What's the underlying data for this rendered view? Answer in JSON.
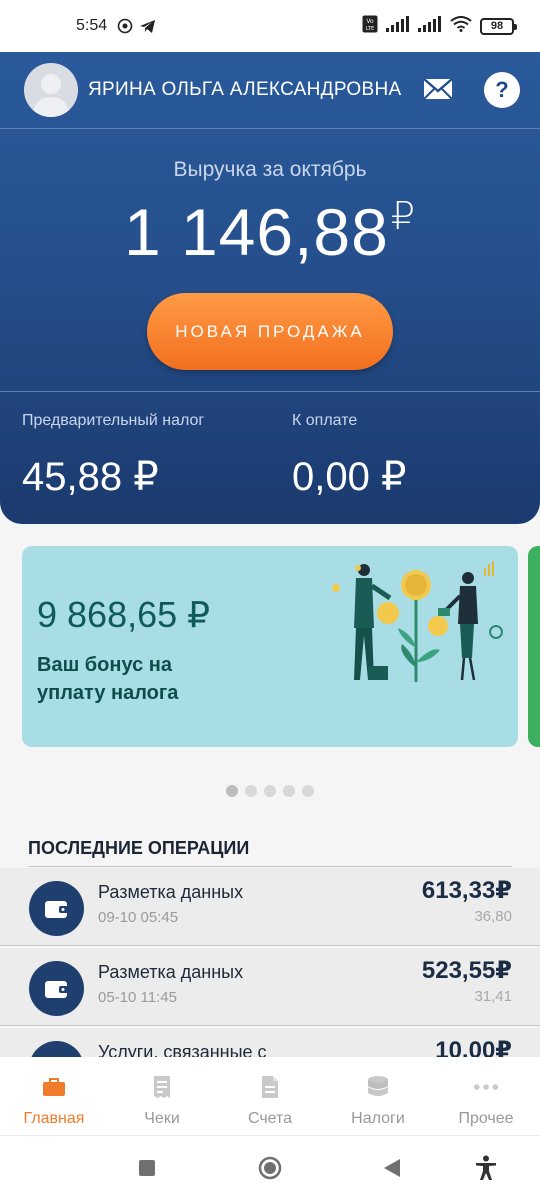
{
  "status_bar": {
    "time": "5:54",
    "battery": "98"
  },
  "header": {
    "user_name": "ЯРИНА ОЛЬГА АЛЕКСАНДРОВНА",
    "help_label": "?"
  },
  "revenue": {
    "label": "Выручка за октябрь",
    "amount": "1 146,88",
    "currency": "₽"
  },
  "new_sale_label": "НОВАЯ ПРОДАЖА",
  "taxes": {
    "prelim_label": "Предварительный налог",
    "prelim_value": "45,88 ₽",
    "due_label": "К оплате",
    "due_value": "0,00 ₽"
  },
  "bonus": {
    "amount": "9 868,65 ₽",
    "text": "Ваш бонус на уплату налога"
  },
  "carousel": {
    "pages": 5,
    "active": 0
  },
  "operations": {
    "title": "ПОСЛЕДНИЕ ОПЕРАЦИИ",
    "items": [
      {
        "name": "Разметка данных",
        "date": "09-10 05:45",
        "sum": "613,33₽",
        "tax": "36,80"
      },
      {
        "name": "Разметка данных",
        "date": "05-10 11:45",
        "sum": "523,55₽",
        "tax": "31,41"
      },
      {
        "name": "Услуги, связанные с",
        "date": "",
        "sum": "10,00₽",
        "tax": ""
      }
    ]
  },
  "bottom_nav": [
    {
      "label": "Главная",
      "icon": "briefcase-icon"
    },
    {
      "label": "Чеки",
      "icon": "receipt-icon"
    },
    {
      "label": "Счета",
      "icon": "document-icon"
    },
    {
      "label": "Налоги",
      "icon": "coins-icon"
    },
    {
      "label": "Прочее",
      "icon": "more-icon"
    }
  ],
  "colors": {
    "header_blue": "#254f8c",
    "accent_orange": "#f07b2a",
    "bonus_bg": "#a9dde6",
    "op_icon_bg": "#1f3f6e"
  }
}
